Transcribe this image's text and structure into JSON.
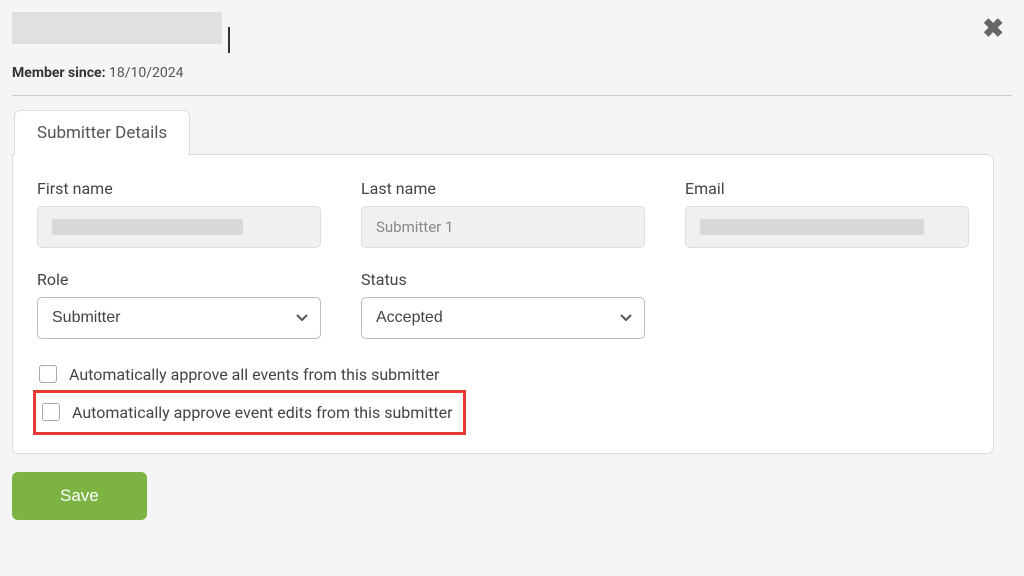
{
  "header": {
    "member_since_label": "Member since:",
    "member_since_value": "18/10/2024"
  },
  "tabs": {
    "active": "Submitter Details"
  },
  "form": {
    "first_name_label": "First name",
    "first_name_value": "",
    "last_name_label": "Last name",
    "last_name_value": "Submitter 1",
    "email_label": "Email",
    "email_value": "",
    "role_label": "Role",
    "role_value": "Submitter",
    "status_label": "Status",
    "status_value": "Accepted",
    "auto_approve_events_label": "Automatically approve all events from this submitter",
    "auto_approve_events_checked": false,
    "auto_approve_edits_label": "Automatically approve event edits from this submitter",
    "auto_approve_edits_checked": false
  },
  "buttons": {
    "save_label": "Save"
  },
  "colors": {
    "accent_green": "#7cb342",
    "highlight_red": "#e53935"
  }
}
